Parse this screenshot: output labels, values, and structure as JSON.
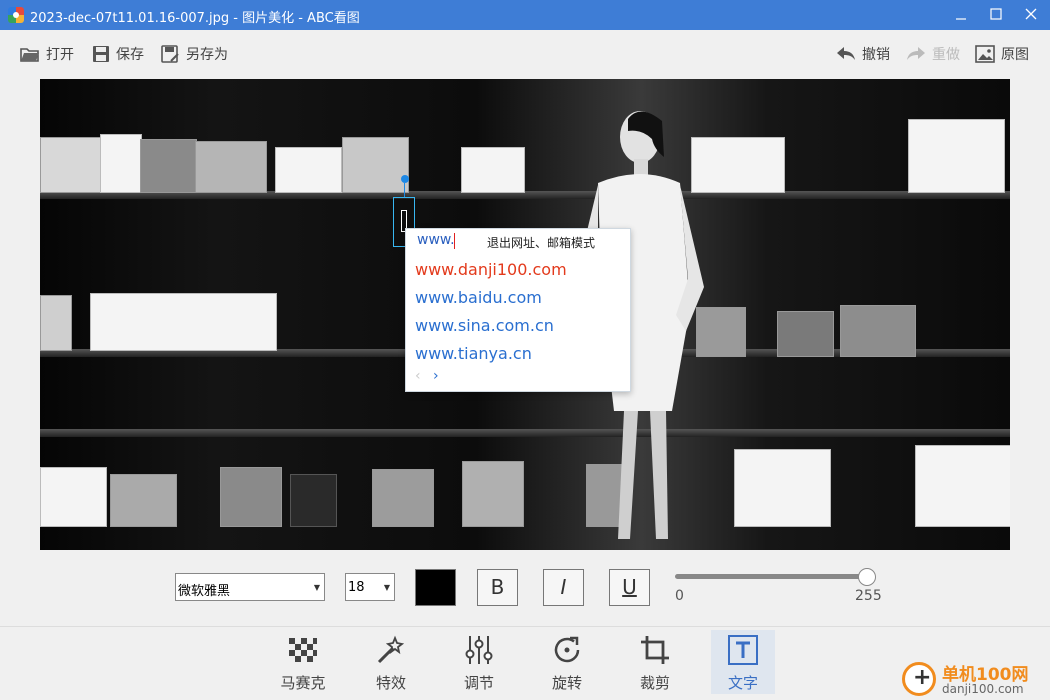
{
  "window": {
    "title": "2023-dec-07t11.01.16-007.jpg - 图片美化 - ABC看图",
    "minimize_icon": "minimize-icon",
    "maximize_icon": "maximize-icon",
    "close_icon": "close-icon"
  },
  "toolbar": {
    "open_label": "打开",
    "save_label": "保存",
    "save_as_label": "另存为",
    "undo_label": "撤销",
    "redo_label": "重做",
    "original_label": "原图"
  },
  "ime": {
    "input": "www.",
    "hint": "退出网址、邮箱模式",
    "candidates": [
      "www.danji100.com",
      "www.baidu.com",
      "www.sina.com.cn",
      "www.tianya.cn"
    ],
    "prev": "‹",
    "next": "›"
  },
  "text_props": {
    "font": "微软雅黑",
    "size": "18",
    "color": "#000000",
    "bold": "B",
    "italic": "I",
    "underline": "U",
    "opacity_value": 255,
    "opacity_min": "0",
    "opacity_max": "255"
  },
  "tools": {
    "mosaic": "马赛克",
    "effects": "特效",
    "adjust": "调节",
    "rotate": "旋转",
    "crop": "裁剪",
    "text": "文字",
    "active": "text"
  },
  "watermark": {
    "name": "单机100网",
    "url": "danji100.com"
  },
  "colors": {
    "titlebar": "#3e7dd6",
    "ime_first": "#e33a1c",
    "ime_link": "#2a6fd0",
    "active_tool": "#3a6fc4"
  }
}
